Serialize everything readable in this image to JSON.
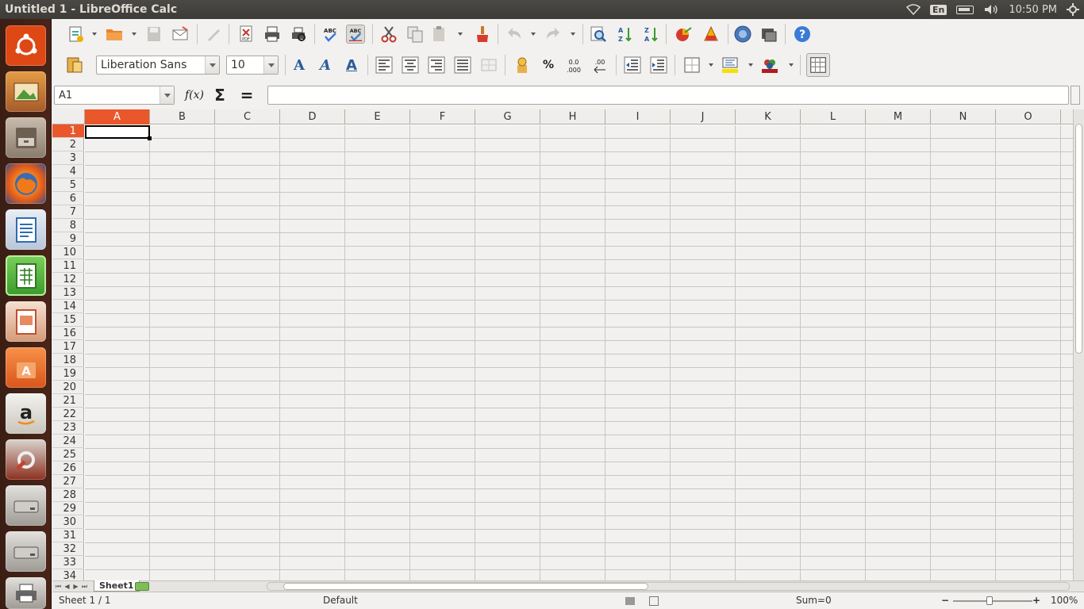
{
  "top_panel": {
    "window_title": "Untitled 1 - LibreOffice Calc",
    "keyboard_layout": "En",
    "clock": "10:50 PM",
    "icons": [
      "wifi-icon",
      "keyboard-indicator",
      "battery-icon",
      "volume-icon",
      "session-gear-icon"
    ]
  },
  "launcher": {
    "items": [
      {
        "name": "ubuntu-dash",
        "glyph": "◉",
        "color": "#dd4814"
      },
      {
        "name": "shotwell",
        "glyph": "🖼",
        "color": "#c06a2b"
      },
      {
        "name": "files",
        "glyph": "▤",
        "color": "#8a7c6d"
      },
      {
        "name": "firefox",
        "glyph": "◍",
        "color": "#e0651a"
      },
      {
        "name": "writer",
        "glyph": "W",
        "color": "#2f6cb0"
      },
      {
        "name": "calc",
        "glyph": "▦",
        "color": "#3a9a2c"
      },
      {
        "name": "impress",
        "glyph": "P",
        "color": "#c0502e"
      },
      {
        "name": "software-center",
        "glyph": "A",
        "color": "#d9561a"
      },
      {
        "name": "amazon",
        "glyph": "a",
        "color": "#d8d4cc"
      },
      {
        "name": "system-settings",
        "glyph": "⚙",
        "color": "#c2452b"
      },
      {
        "name": "drive-1",
        "glyph": "▭",
        "color": "#9e9a94"
      },
      {
        "name": "drive-2",
        "glyph": "▭",
        "color": "#9e9a94"
      },
      {
        "name": "printer",
        "glyph": "▬",
        "color": "#888"
      }
    ]
  },
  "toolbar": {
    "font_name": "Liberation Sans",
    "font_size": "10"
  },
  "formula_bar": {
    "name_box": "A1",
    "function_wizard": "f(x)",
    "sum_symbol": "Σ",
    "equals_symbol": "=",
    "formula_value": ""
  },
  "grid": {
    "columns": [
      "A",
      "B",
      "C",
      "D",
      "E",
      "F",
      "G",
      "H",
      "I",
      "J",
      "K",
      "L",
      "M",
      "N",
      "O"
    ],
    "rows": [
      "1",
      "2",
      "3",
      "4",
      "5",
      "6",
      "7",
      "8",
      "9",
      "10",
      "11",
      "12",
      "13",
      "14",
      "15",
      "16",
      "17",
      "18",
      "19",
      "20",
      "21",
      "22",
      "23",
      "24",
      "25",
      "26",
      "27",
      "28",
      "29",
      "30",
      "31",
      "32",
      "33",
      "34"
    ],
    "active_column": "A",
    "active_row": "1",
    "accent_color": "#e9572a"
  },
  "sheet_tabs": {
    "tabs": [
      "Sheet1"
    ]
  },
  "status_bar": {
    "sheet_position": "Sheet 1 / 1",
    "page_style": "Default",
    "sum": "Sum=0",
    "zoom": "100%"
  }
}
